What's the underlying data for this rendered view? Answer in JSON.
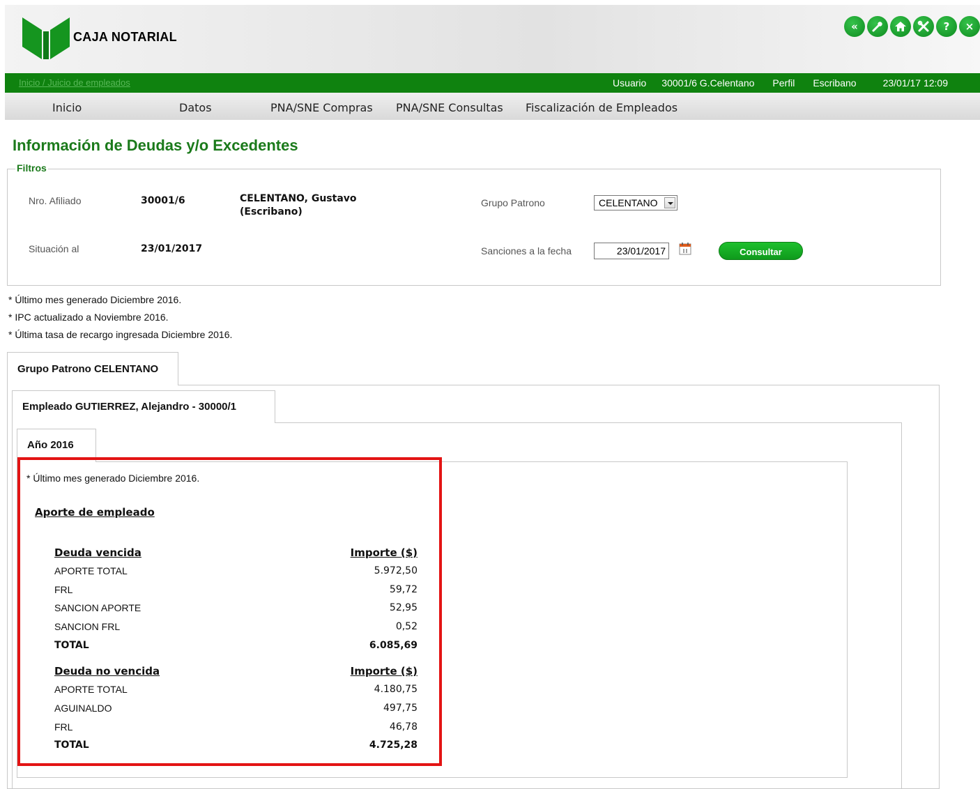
{
  "header": {
    "brand": "CAJA NOTARIAL",
    "icons": [
      "back-icon",
      "key-icon",
      "home-icon",
      "tools-icon",
      "help-icon",
      "close-icon"
    ],
    "icon_glyphs": [
      "«",
      "",
      "",
      "",
      "?",
      "×"
    ],
    "accent": "#0f820f"
  },
  "statusbar": {
    "breadcrumb_home": "Inicio",
    "breadcrumb_sep": "/",
    "breadcrumb_current": "Juicio de empleados",
    "usuario_label": "Usuario",
    "usuario_value": "30001/6 G.Celentano",
    "perfil_label": "Perfil",
    "perfil_value": "Escribano",
    "datetime": "23/01/17 12:09"
  },
  "menu": {
    "items": [
      "Inicio",
      "Datos",
      "PNA/SNE Compras",
      "PNA/SNE Consultas",
      "Fiscalización de Empleados"
    ]
  },
  "page": {
    "title": "Información de Deudas y/o Excedentes"
  },
  "filters": {
    "legend": "Filtros",
    "afiliado_label": "Nro. Afiliado",
    "afiliado_value": "30001/6",
    "nombre_line1": "CELENTANO, Gustavo",
    "nombre_line2": "(Escribano)",
    "grupo_label": "Grupo Patrono",
    "grupo_value": "CELENTANO",
    "situacion_label": "Situación al",
    "situacion_value": "23/01/2017",
    "sanciones_label": "Sanciones a la fecha",
    "sanciones_value": "23/01/2017",
    "consultar_label": "Consultar"
  },
  "notes": [
    "* Último mes generado Diciembre 2016.",
    "* IPC actualizado a Noviembre 2016.",
    "* Última tasa de recargo ingresada Diciembre 2016."
  ],
  "tabs": {
    "grupo": "Grupo Patrono CELENTANO",
    "empleado": "Empleado GUTIERREZ, Alejandro - 30000/1",
    "anio": "Año 2016"
  },
  "detail": {
    "note": "* Último mes generado Diciembre 2016.",
    "section": "Aporte de empleado",
    "vencida": {
      "header": "Deuda vencida",
      "amount_header": "Importe ($)",
      "rows": [
        {
          "concept": "APORTE TOTAL",
          "amount": "5.972,50"
        },
        {
          "concept": "FRL",
          "amount": "59,72"
        },
        {
          "concept": "SANCION APORTE",
          "amount": "52,95"
        },
        {
          "concept": "SANCION FRL",
          "amount": "0,52"
        }
      ],
      "total_label": "TOTAL",
      "total_amount": "6.085,69"
    },
    "no_vencida": {
      "header": "Deuda no vencida",
      "amount_header": "Importe ($)",
      "rows": [
        {
          "concept": "APORTE TOTAL",
          "amount": "4.180,75"
        },
        {
          "concept": "AGUINALDO",
          "amount": "497,75"
        },
        {
          "concept": "FRL",
          "amount": "46,78"
        }
      ],
      "total_label": "TOTAL",
      "total_amount": "4.725,28"
    }
  }
}
